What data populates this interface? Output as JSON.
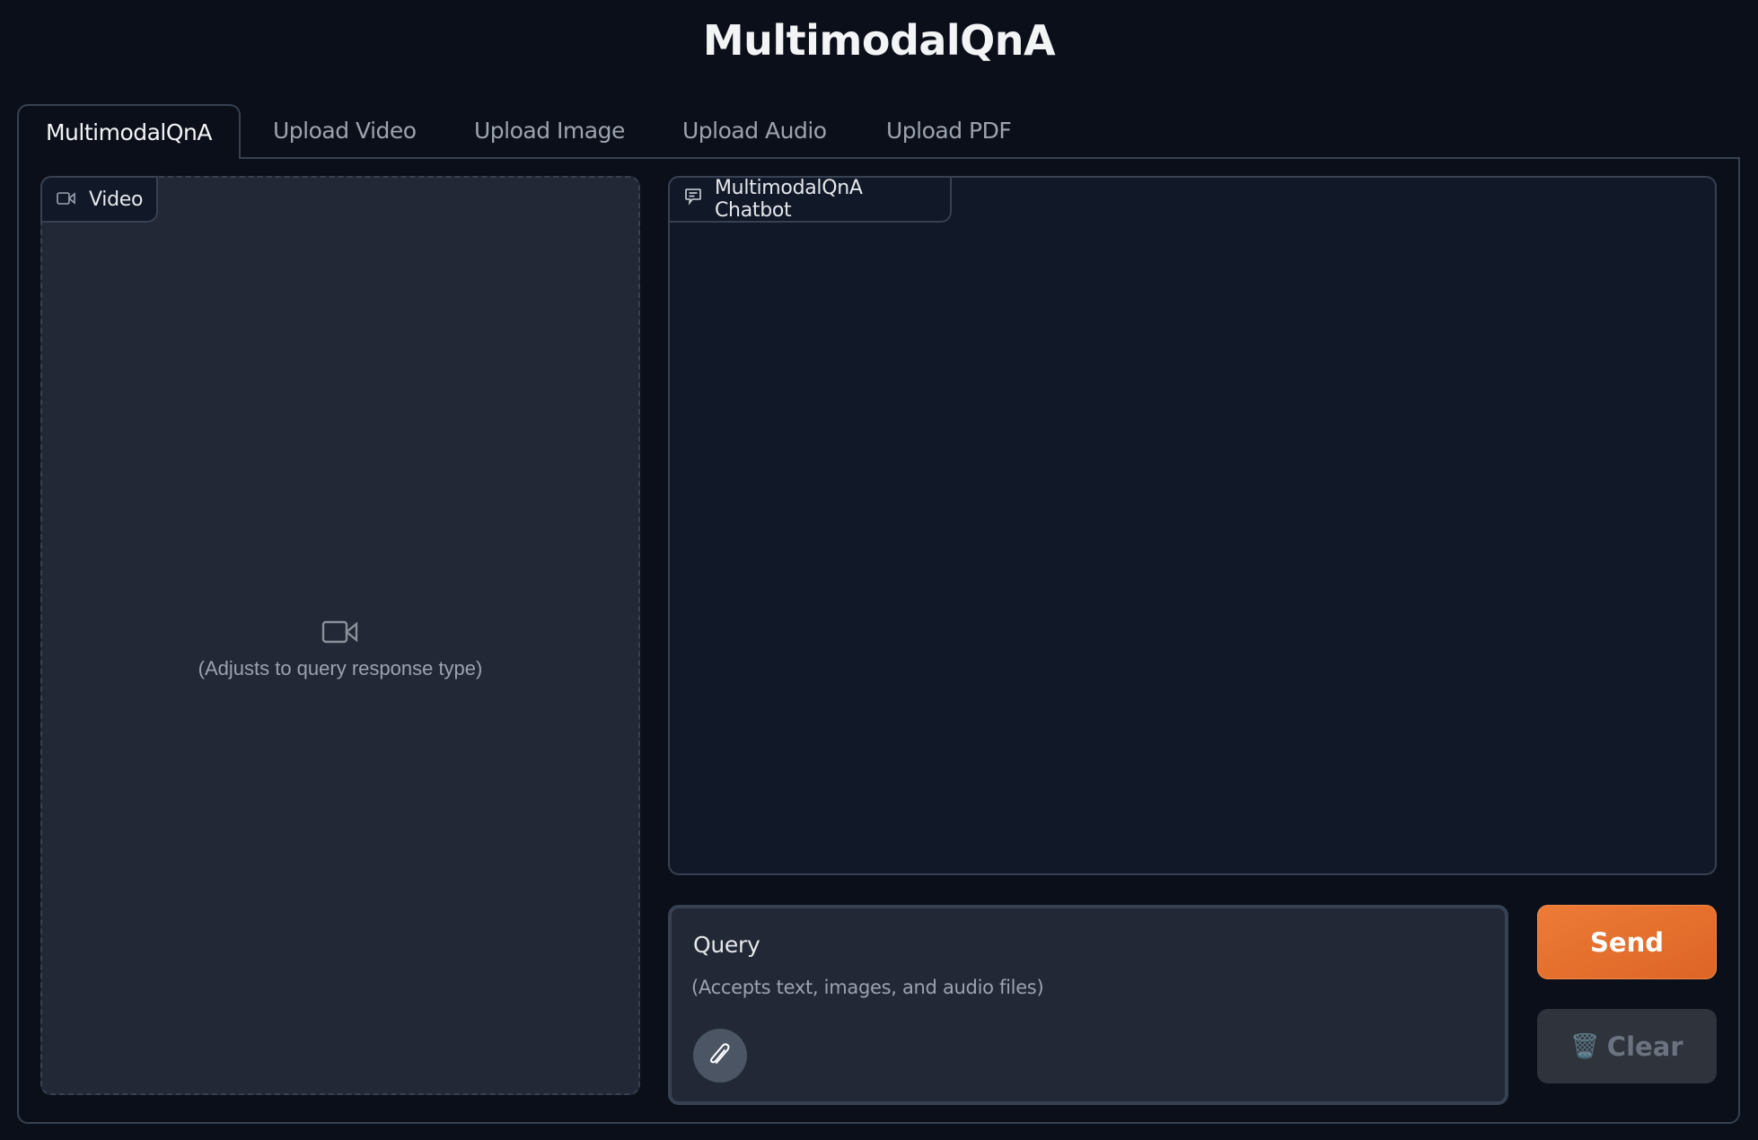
{
  "app": {
    "title": "MultimodalQnA"
  },
  "tabs": [
    {
      "label": "MultimodalQnA",
      "active": true
    },
    {
      "label": "Upload Video",
      "active": false
    },
    {
      "label": "Upload Image",
      "active": false
    },
    {
      "label": "Upload Audio",
      "active": false
    },
    {
      "label": "Upload PDF",
      "active": false
    }
  ],
  "video_panel": {
    "label": "Video",
    "icon": "video-camera-icon",
    "placeholder_text": "(Adjusts to query response type)"
  },
  "chatbot": {
    "label": "MultimodalQnA Chatbot",
    "icon": "chat-bubble-icon",
    "messages": []
  },
  "query": {
    "label": "Query",
    "value": "",
    "placeholder": "(Accepts text, images, and audio files)",
    "attach_icon": "paperclip-icon"
  },
  "buttons": {
    "send_label": "Send",
    "clear_label": "Clear",
    "clear_icon": "🗑️"
  },
  "colors": {
    "background": "#0b0f19",
    "accent": "#e8702f",
    "panel": "#222836",
    "border": "#374151"
  }
}
